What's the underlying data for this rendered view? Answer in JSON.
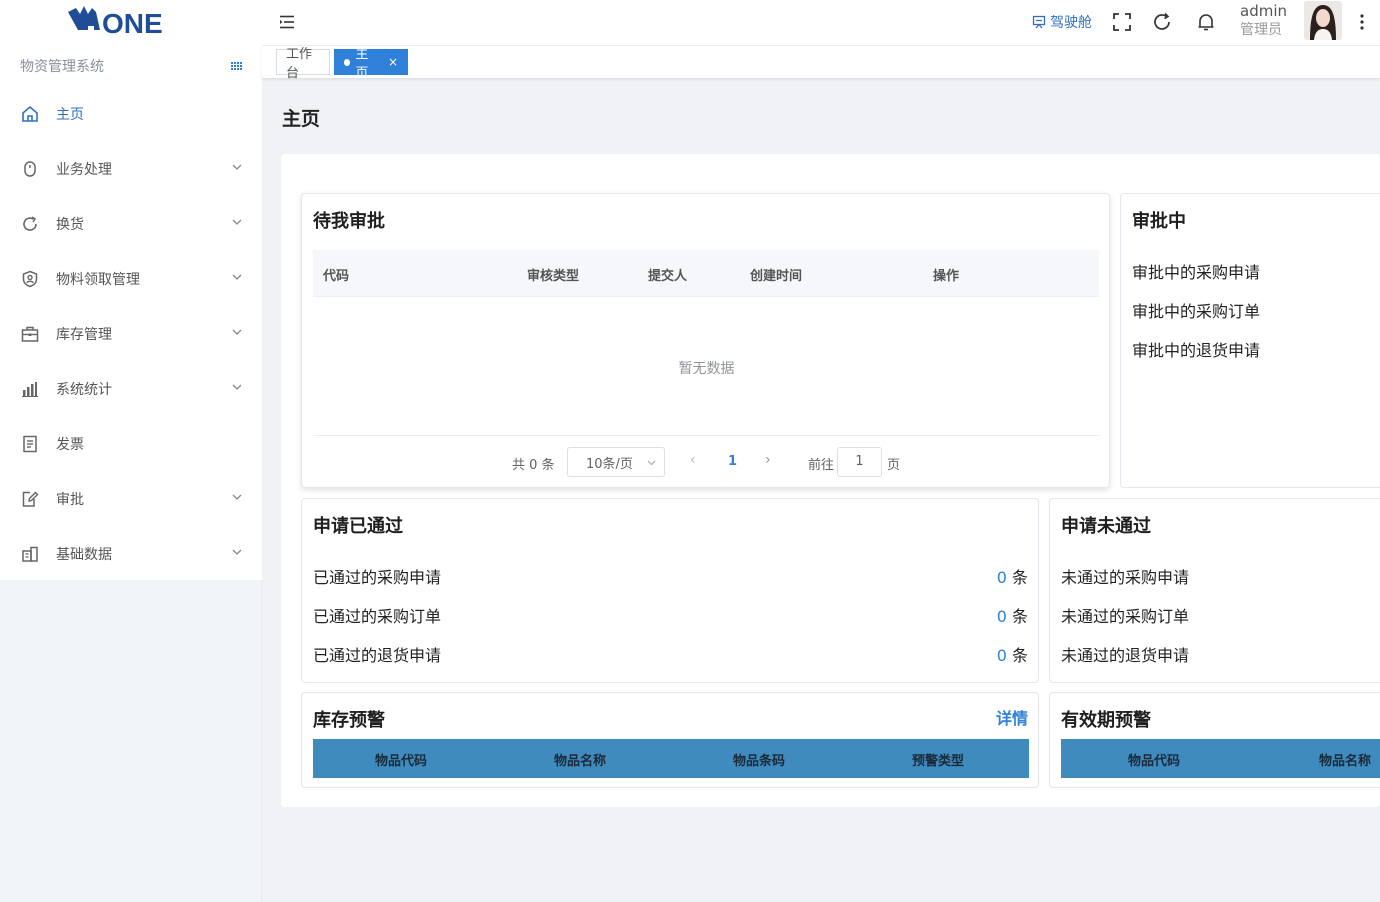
{
  "app": {
    "logo_text": "ONE",
    "system_name": "物资管理系统"
  },
  "sidebar": {
    "items": [
      {
        "label": "主页",
        "icon": "home-icon",
        "active": true,
        "expandable": false
      },
      {
        "label": "业务处理",
        "icon": "mouse-icon",
        "active": false,
        "expandable": true
      },
      {
        "label": "换货",
        "icon": "refresh-icon",
        "active": false,
        "expandable": true
      },
      {
        "label": "物料领取管理",
        "icon": "shield-user-icon",
        "active": false,
        "expandable": true
      },
      {
        "label": "库存管理",
        "icon": "briefcase-icon",
        "active": false,
        "expandable": true
      },
      {
        "label": "系统统计",
        "icon": "bar-chart-icon",
        "active": false,
        "expandable": true
      },
      {
        "label": "发票",
        "icon": "document-icon",
        "active": false,
        "expandable": false
      },
      {
        "label": "审批",
        "icon": "edit-doc-icon",
        "active": false,
        "expandable": true
      },
      {
        "label": "基础数据",
        "icon": "building-chart-icon",
        "active": false,
        "expandable": true
      }
    ]
  },
  "header": {
    "cockpit_label": "驾驶舱",
    "user": {
      "name": "admin",
      "role": "管理员"
    }
  },
  "tabs": [
    {
      "label": "工作台",
      "active": false
    },
    {
      "label": "主页",
      "active": true
    }
  ],
  "page": {
    "title": "主页"
  },
  "pending": {
    "title": "待我审批",
    "columns": [
      "代码",
      "审核类型",
      "提交人",
      "创建时间",
      "操作"
    ],
    "empty_text": "暂无数据",
    "pagination": {
      "total_text": "共 0 条",
      "page_size": "10条/页",
      "current_page": "1",
      "goto_label": "前往",
      "goto_value": "1",
      "page_suffix": "页"
    }
  },
  "in_process": {
    "title": "审批中",
    "items": [
      "审批中的采购申请",
      "审批中的采购订单",
      "审批中的退货申请"
    ]
  },
  "passed": {
    "title": "申请已通过",
    "unit": "条",
    "items": [
      {
        "label": "已通过的采购申请",
        "count": "0"
      },
      {
        "label": "已通过的采购订单",
        "count": "0"
      },
      {
        "label": "已通过的退货申请",
        "count": "0"
      }
    ]
  },
  "failed": {
    "title": "申请未通过",
    "items": [
      "未通过的采购申请",
      "未通过的采购订单",
      "未通过的退货申请"
    ]
  },
  "stock_warning": {
    "title": "库存预警",
    "detail_label": "详情",
    "columns": [
      "物品代码",
      "物品名称",
      "物品条码",
      "预警类型"
    ]
  },
  "expiry_warning": {
    "title": "有效期预警",
    "columns": [
      "物品代码",
      "物品名称"
    ]
  },
  "colors": {
    "accent": "#2f80d8",
    "table_header": "#3f8bbd",
    "sidebar_bg": "#f1f4f8"
  }
}
